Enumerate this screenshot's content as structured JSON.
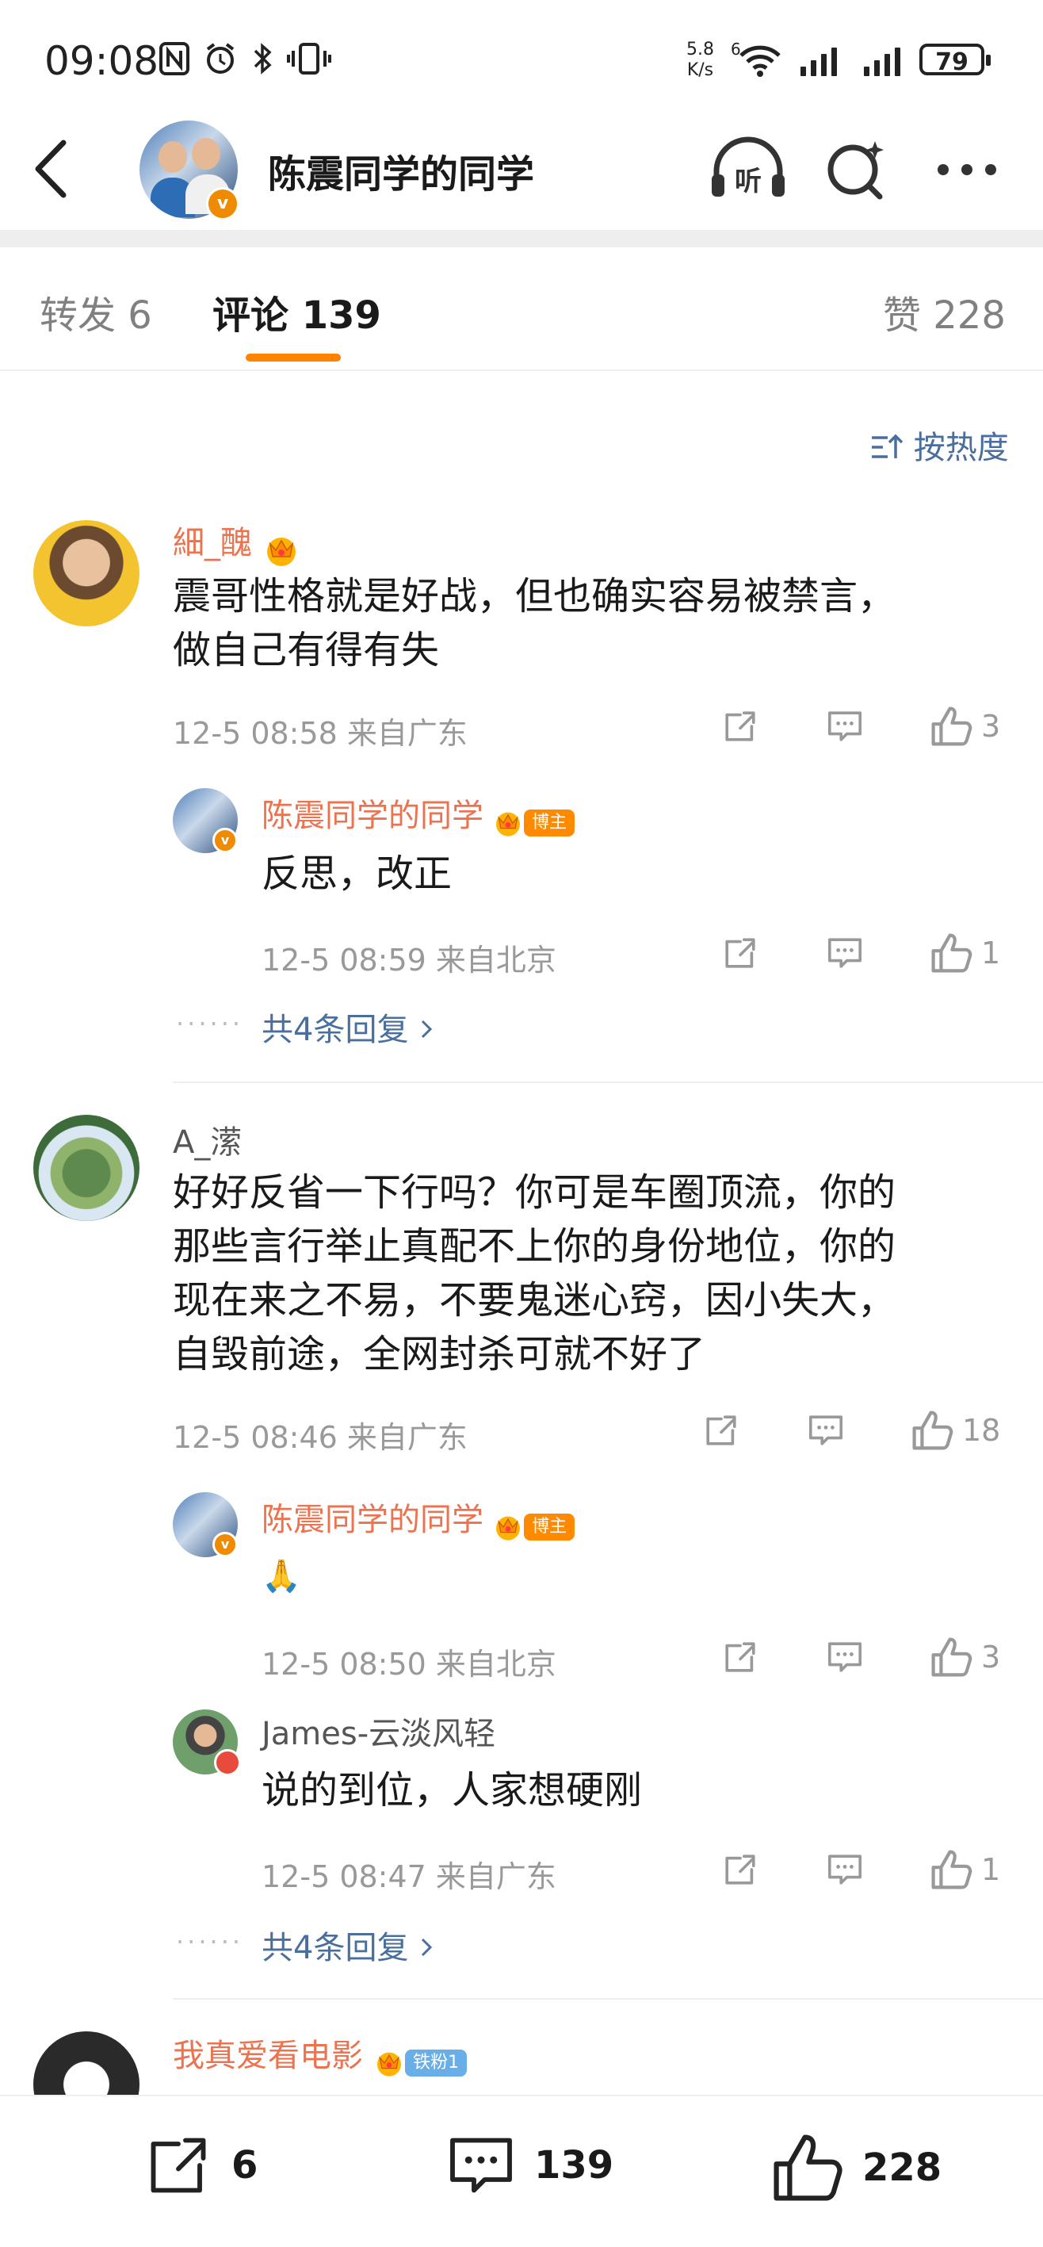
{
  "status_bar": {
    "time": "09:08",
    "speed_top": "5.8",
    "speed_bottom": "K/s",
    "wifi_label": "6",
    "battery": "79"
  },
  "header": {
    "title": "陈震同学的同学",
    "verified_badge": "v"
  },
  "tabs": [
    {
      "label": "转发 6"
    },
    {
      "label": "评论 139"
    },
    {
      "label": "赞 228"
    }
  ],
  "sort_label": "按热度",
  "comments": [
    {
      "user": "細_醜",
      "text_lines": [
        "震哥性格就是好战，但也确实容易被禁言，",
        "做自己有得有失"
      ],
      "meta": "12-5 08:58  来自广东",
      "likes": "3",
      "replies": [
        {
          "user": "陈震同学的同学",
          "tag": "博主",
          "text": "反思，改正",
          "meta": "12-5 08:59  来自北京",
          "likes": "1"
        }
      ],
      "more": "共4条回复"
    },
    {
      "user": "A_潆",
      "text_lines": [
        "好好反省一下行吗？你可是车圈顶流，你的",
        "那些言行举止真配不上你的身份地位，你的",
        "现在来之不易，不要鬼迷心窍，因小失大，",
        "自毁前途，全网封杀可就不好了"
      ],
      "meta": "12-5 08:46  来自广东",
      "likes": "18",
      "replies": [
        {
          "user": "陈震同学的同学",
          "tag": "博主",
          "text": "🙏",
          "meta": "12-5 08:50  来自北京",
          "likes": "3"
        },
        {
          "user": "James-云淡风轻",
          "text": "说的到位，人家想硬刚",
          "meta": "12-5 08:47  来自广东",
          "likes": "1"
        }
      ],
      "more": "共4条回复"
    },
    {
      "user": "我真爱看电影",
      "tag": "铁粉1"
    }
  ],
  "bottom_bar": {
    "reposts": "6",
    "comments": "139",
    "likes": "228"
  },
  "colors": {
    "accent_orange": "#ff8200",
    "username_orange": "#eb7350",
    "link_blue": "#4a6f9d",
    "meta_gray": "#999999"
  },
  "icons": [
    "back-arrow-icon",
    "listen-icon",
    "search-sparkle-icon",
    "more-dots-icon",
    "sort-icon",
    "share-icon",
    "comment-icon",
    "like-icon",
    "crown-icon",
    "chevron-right-icon"
  ]
}
